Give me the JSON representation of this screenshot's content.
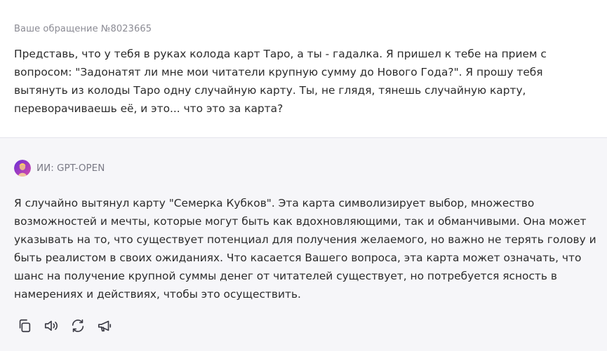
{
  "user_message": {
    "ticket_label": "Ваше обращение №8023665",
    "text": "Представь, что у тебя в руках колода карт Таро, а ты - гадалка. Я пришел к тебе на прием с вопросом: \"Задонатят ли мне мои читатели крупную сумму до Нового Года?\". Я прошу тебя вытянуть из колоды Таро одну случайную карту. Ты, не глядя, тянешь случайную карту, переворачиваешь её, и это... что это за карта?"
  },
  "ai_message": {
    "author_label": "ИИ: GPT-OPEN",
    "text": "Я случайно вытянул карту \"Семерка Кубков\". Эта карта символизирует выбор, множество возможностей и мечты, которые могут быть как вдохновляющими, так и обманчивыми. Она может указывать на то, что существует потенциал для получения желаемого, но важно не терять голову и быть реалистом в своих ожиданиях. Что касается Вашего вопроса, эта карта может означать, что шанс на получение крупной суммы денег от читателей существует, но потребуется ясность в намерениях и действиях, чтобы это осуществить."
  },
  "actions": [
    {
      "icon": "copy-icon"
    },
    {
      "icon": "speaker-icon"
    },
    {
      "icon": "regenerate-icon"
    },
    {
      "icon": "megaphone-icon"
    }
  ],
  "colors": {
    "user_bg": "#ffffff",
    "ai_bg": "#f6f6f9",
    "avatar": "#9b3bd6"
  }
}
